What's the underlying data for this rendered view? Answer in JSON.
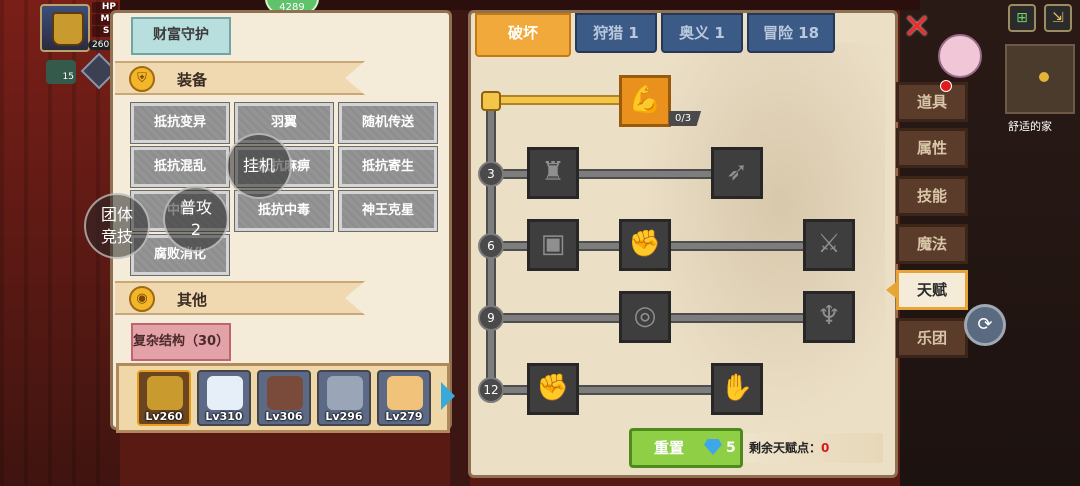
{
  "hud": {
    "stats": [
      "HP",
      "MP",
      "SP"
    ],
    "level": "260",
    "badge_count": "15",
    "pill_text": "4289"
  },
  "floating": {
    "team_arena": "团体\n竞技",
    "normal_attack": "普攻\n2",
    "idle": "挂机"
  },
  "left_panel": {
    "selected_item": "财富守护",
    "equipment_section": {
      "title": "装备",
      "icon": "armor-icon"
    },
    "equipment_items": [
      "抵抗变异",
      "羽翼",
      "随机传送",
      "抵抗混乱",
      "抵抗麻痹",
      "抵抗寄生",
      "中断",
      "抵抗中毒",
      "神王克星",
      "腐败消化"
    ],
    "other_section": {
      "title": "其他",
      "icon": "coin-icon"
    },
    "other_item": "复杂结构（30）"
  },
  "heroes": [
    {
      "level": "Lv260",
      "selected": true,
      "color": "#c99a2e"
    },
    {
      "level": "Lv310",
      "selected": false,
      "color": "#e6eef7"
    },
    {
      "level": "Lv306",
      "selected": false,
      "color": "#7a4a3a"
    },
    {
      "level": "Lv296",
      "selected": false,
      "color": "#9aa6b8"
    },
    {
      "level": "Lv279",
      "selected": false,
      "color": "#f1c27a"
    }
  ],
  "talent_tabs": [
    {
      "label": "破坏",
      "active": true
    },
    {
      "label": "狩猎 1",
      "active": false
    },
    {
      "label": "奥义 1",
      "active": false
    },
    {
      "label": "冒险 18",
      "active": false
    }
  ],
  "talent_tree": {
    "top_node_progress": "0/3",
    "tiers": [
      "3",
      "6",
      "9",
      "12"
    ],
    "node_icons": {
      "top": "arm-wrestle-icon",
      "tier3": [
        "muscle-body-icon",
        "arrow-hit-icon"
      ],
      "tier6": [
        "shield-card-icon",
        "fist-icon",
        "sword-slash-icon"
      ],
      "tier9": [
        "ripple-icon",
        "bat-wing-icon"
      ],
      "tier12": [
        "raised-fist-icon",
        "gauntlet-icon"
      ]
    }
  },
  "reset": {
    "label": "重置",
    "cost": "5"
  },
  "remaining": {
    "label": "剩余天赋点：",
    "value": "0"
  },
  "side_tabs": [
    {
      "label": "道具",
      "active": false
    },
    {
      "label": "属性",
      "active": false
    },
    {
      "label": "技能",
      "active": false
    },
    {
      "label": "魔法",
      "active": false
    },
    {
      "label": "天赋",
      "active": true
    },
    {
      "label": "乐团",
      "active": false
    }
  ],
  "map": {
    "location": "舒适的家"
  },
  "colors": {
    "accent_orange": "#f2a93b",
    "tab_blue": "#3c5a86",
    "reset_green": "#8ecf45",
    "points_red": "#d41a1a"
  }
}
